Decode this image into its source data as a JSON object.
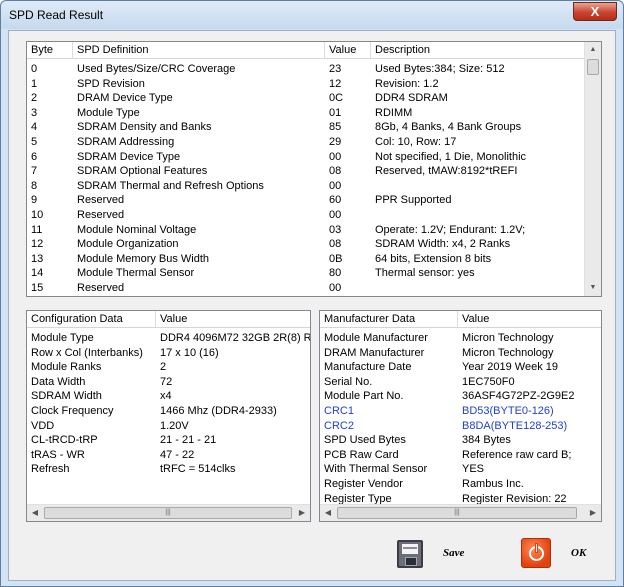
{
  "window": {
    "title": "SPD Read Result",
    "close_glyph": "X"
  },
  "spd_table": {
    "headers": [
      "Byte",
      "SPD Definition",
      "Value",
      "Description"
    ],
    "rows": [
      [
        "0",
        "Used Bytes/Size/CRC Coverage",
        "23",
        "Used Bytes:384; Size: 512"
      ],
      [
        "1",
        "SPD Revision",
        "12",
        "Revision: 1.2"
      ],
      [
        "2",
        "DRAM Device Type",
        "0C",
        "DDR4 SDRAM"
      ],
      [
        "3",
        "Module Type",
        "01",
        "RDIMM"
      ],
      [
        "4",
        "SDRAM Density and Banks",
        "85",
        "8Gb, 4 Banks, 4 Bank Groups"
      ],
      [
        "5",
        "SDRAM Addressing",
        "29",
        "Col: 10, Row: 17"
      ],
      [
        "6",
        "SDRAM Device Type",
        "00",
        "Not specified, 1 Die, Monolithic"
      ],
      [
        "7",
        "SDRAM Optional Features",
        "08",
        "Reserved, tMAW:8192*tREFI"
      ],
      [
        "8",
        "SDRAM Thermal and Refresh Options",
        "00",
        ""
      ],
      [
        "9",
        "Reserved",
        "60",
        "PPR Supported"
      ],
      [
        "10",
        "Reserved",
        "00",
        ""
      ],
      [
        "11",
        "Module Nominal Voltage",
        "03",
        "Operate: 1.2V; Endurant: 1.2V;"
      ],
      [
        "12",
        "Module Organization",
        "08",
        "SDRAM Width: x4, 2 Ranks"
      ],
      [
        "13",
        "Module Memory Bus Width",
        "0B",
        "64 bits, Extension 8 bits"
      ],
      [
        "14",
        "Module Thermal Sensor",
        "80",
        "Thermal sensor: yes"
      ],
      [
        "15",
        "Reserved",
        "00",
        ""
      ]
    ]
  },
  "config_table": {
    "headers": [
      "Configuration Data",
      "Value"
    ],
    "rows": [
      [
        "Module Type",
        "DDR4 4096M72 32GB 2R(8) R"
      ],
      [
        "Row x Col (Interbanks)",
        "17 x 10 (16)"
      ],
      [
        "Module Ranks",
        "2"
      ],
      [
        "Data Width",
        "72"
      ],
      [
        "SDRAM Width",
        "x4"
      ],
      [
        "Clock Frequency",
        "1466 Mhz (DDR4-2933)"
      ],
      [
        "VDD",
        "1.20V"
      ],
      [
        "CL-tRCD-tRP",
        "21 - 21 - 21"
      ],
      [
        "tRAS - WR",
        "47 - 22"
      ],
      [
        "Refresh",
        "tRFC = 514clks"
      ]
    ]
  },
  "manufacturer_table": {
    "headers": [
      "Manufacturer Data",
      "Value"
    ],
    "rows": [
      [
        "Module Manufacturer",
        "Micron Technology",
        false
      ],
      [
        "DRAM Manufacturer",
        "Micron Technology",
        false
      ],
      [
        "Manufacture Date",
        "Year 2019 Week 19",
        false
      ],
      [
        "Serial No.",
        "1EC750F0",
        false
      ],
      [
        "Module Part No.",
        "36ASF4G72PZ-2G9E2",
        false
      ],
      [
        "CRC1",
        "BD53(BYTE0-126)",
        true
      ],
      [
        "CRC2",
        "B8DA(BYTE128-253)",
        true
      ],
      [
        "SPD Used Bytes",
        "384 Bytes",
        false
      ],
      [
        "PCB Raw Card",
        "Reference raw card B;",
        false
      ],
      [
        "With Thermal Sensor",
        "YES",
        false
      ],
      [
        "Register Vendor",
        "Rambus Inc.",
        false
      ],
      [
        "Register Type",
        "Register Revision: 22",
        false
      ]
    ]
  },
  "buttons": {
    "save_label": "Save",
    "ok_label": "OK"
  },
  "colors": {
    "crc_text": "#1f3fd6",
    "ok_icon": "#e2420d"
  },
  "icons": {
    "save": "floppy-disk-icon",
    "ok": "power-icon"
  }
}
